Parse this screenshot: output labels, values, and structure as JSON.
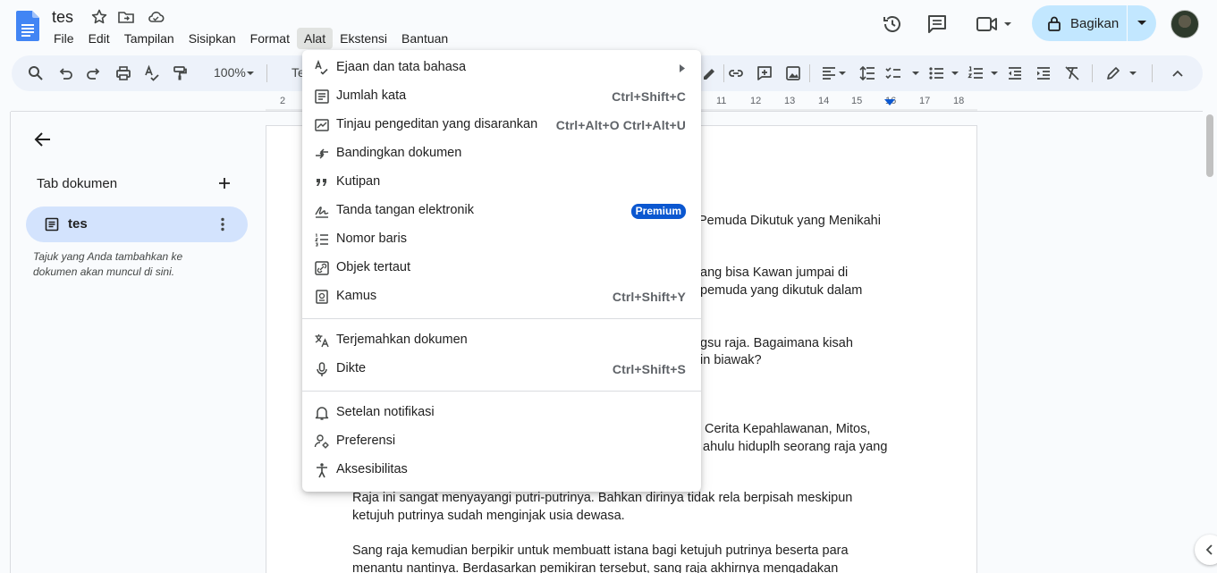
{
  "doc": {
    "title": "tes"
  },
  "menubar": [
    "File",
    "Edit",
    "Tampilan",
    "Sisipkan",
    "Format",
    "Alat",
    "Ekstensi",
    "Bantuan"
  ],
  "share": {
    "label": "Bagikan"
  },
  "toolbar": {
    "zoom": "100%",
    "style": "Teks"
  },
  "ruler": [
    "2",
    "11",
    "12",
    "13",
    "14",
    "15",
    "16",
    "17",
    "18"
  ],
  "sidepanel": {
    "title": "Tab dokumen",
    "tab_label": "tes",
    "hint": "Tajuk yang Anda tambahkan ke dokumen akan muncul di sini."
  },
  "page": {
    "lines": [
      "Pemuda Dikutuk yang Menikahi",
      "ang bisa Kawan jumpai di",
      "pemuda yang dikutuk dalam",
      "gsu raja. Bagaimana kisah",
      "in biawak?",
      "Cerita Kepahlawanan, Mitos,",
      "ahulu hiduplh seorang raja yang",
      "Raja ini sangat menyayangi putri-putrinya. Bahkan dirinya tidak rela berpisah meskipun",
      "ketujuh putrinya sudah menginjak usia dewasa.",
      "Sang raja kemudian berpikir untuk membuatt istana bagi ketujuh putrinya beserta para",
      "menantu nantinya. Berdasarkan pemikiran tersebut, sang raja akhirnya mengadakan"
    ]
  },
  "tools_menu": {
    "items": [
      {
        "label": "Ejaan dan tata bahasa",
        "icon": "spellcheck-icon",
        "submenu": true
      },
      {
        "label": "Jumlah kata",
        "icon": "word-count-icon",
        "shortcut": "Ctrl+Shift+C"
      },
      {
        "label": "Tinjau pengeditan yang disarankan",
        "icon": "review-edits-icon",
        "shortcut": "Ctrl+Alt+O Ctrl+Alt+U"
      },
      {
        "label": "Bandingkan dokumen",
        "icon": "compare-icon"
      },
      {
        "label": "Kutipan",
        "icon": "quote-icon"
      },
      {
        "label": "Tanda tangan elektronik",
        "icon": "signature-icon",
        "badge": "Premium"
      },
      {
        "label": "Nomor baris",
        "icon": "line-numbers-icon"
      },
      {
        "label": "Objek tertaut",
        "icon": "linked-objects-icon"
      },
      {
        "label": "Kamus",
        "icon": "dictionary-icon",
        "shortcut": "Ctrl+Shift+Y"
      },
      {
        "label": "Terjemahkan dokumen",
        "icon": "translate-icon"
      },
      {
        "label": "Dikte",
        "icon": "microphone-icon",
        "shortcut": "Ctrl+Shift+S"
      },
      {
        "label": "Setelan notifikasi",
        "icon": "bell-icon"
      },
      {
        "label": "Preferensi",
        "icon": "preferences-icon"
      },
      {
        "label": "Aksesibilitas",
        "icon": "accessibility-icon"
      }
    ]
  }
}
